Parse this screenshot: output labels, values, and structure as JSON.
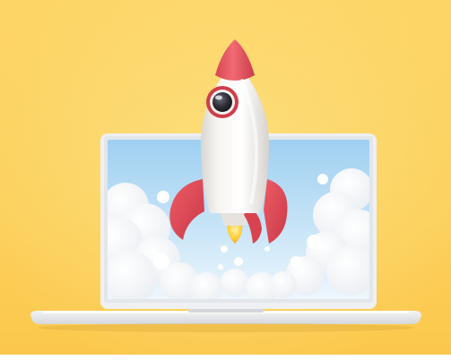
{
  "scene": {
    "subject": "rocket",
    "device": "laptop",
    "colors": {
      "background": "#fccf5a",
      "background_light": "#fde07f",
      "rocket_body": "#f4f2ef",
      "rocket_accent": "#e8535f",
      "rocket_accent_dark": "#c93b48",
      "window_ring": "#cf3d4a",
      "window_glass": "#2b2b33",
      "laptop_frame": "#eef0f3",
      "screen_sky_top": "#a9d6f3",
      "screen_sky_bottom": "#e6f3fb",
      "cloud": "#ffffff",
      "flame": "#ffcf3a"
    }
  }
}
